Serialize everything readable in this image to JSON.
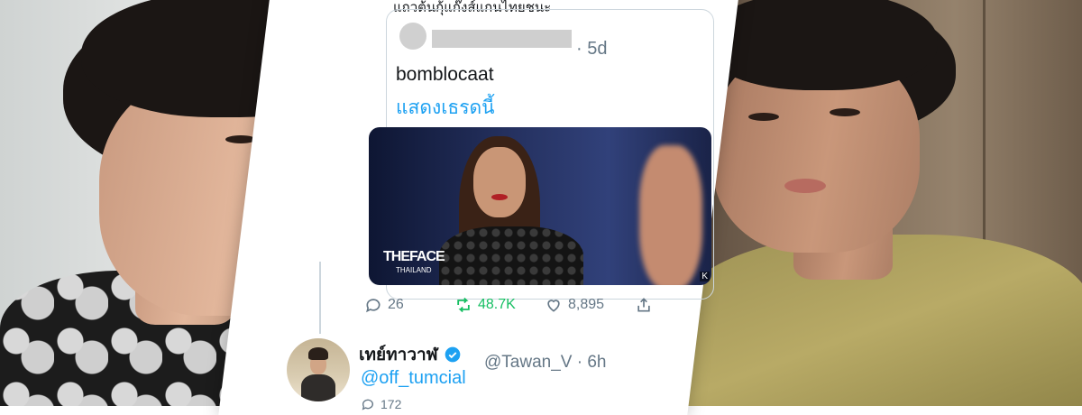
{
  "header_text": "แถวต้นกุ้แก๊งส์แกนไทยชนะ",
  "quoted_tweet": {
    "time": "· 5d",
    "text": "bomblocaat",
    "link": "แสดงเธรดนี้",
    "media": {
      "logo": "THEFACE",
      "logo_sub": "THAILAND",
      "corner_mark": "K"
    }
  },
  "actions": {
    "replies": "26",
    "retweets": "48.7K",
    "likes": "8,895"
  },
  "reply_tweet": {
    "name": "เทย์ทาวาฬ",
    "handle": "@Tawan_V · 6h",
    "mention": "@off_tumcial",
    "reply_count": "172"
  },
  "colors": {
    "link": "#1da1f2",
    "retweet": "#17bf63",
    "muted": "#657786"
  },
  "icons": [
    "reply-icon",
    "retweet-icon",
    "like-icon",
    "share-icon",
    "verified-badge-icon"
  ]
}
